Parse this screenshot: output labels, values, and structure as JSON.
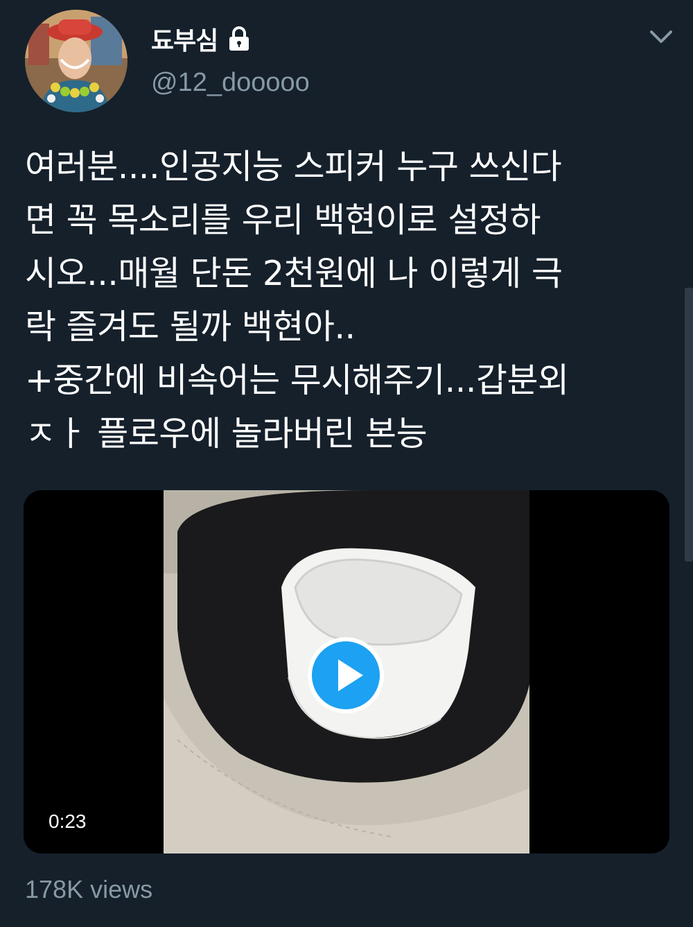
{
  "tweet": {
    "display_name": "됴부심",
    "handle": "@12_dooooo",
    "lock_icon": "lock-icon",
    "menu_icon": "chevron-down-icon",
    "text_lines": [
      "여러분....인공지능 스피커 누구 쓰신다",
      "면 꼭 목소리를 우리 백현이로 설정하",
      "시오...매월 단돈 2천원에 나 이렇게 극",
      "락 즐겨도 될까 백현아..",
      "+중간에 비속어는 무시해주기...갑분외",
      "ㅈㅏ 플로우에 놀라버린 본능"
    ]
  },
  "video": {
    "duration": "0:23",
    "play_icon": "play-icon"
  },
  "stats": {
    "views": "178K views"
  },
  "colors": {
    "background": "#15202b",
    "accent": "#1da1f2",
    "secondary_text": "#8899a6"
  }
}
